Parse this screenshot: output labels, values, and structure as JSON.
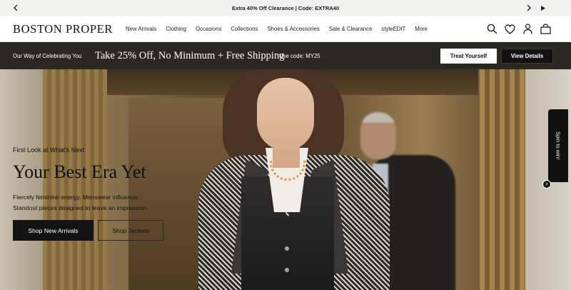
{
  "announcement": {
    "text": "Extra 40% Off Clearance | Code: EXTRA40",
    "prev_icon": "chevron-left-icon",
    "next_icon": "chevron-right-icon",
    "play_icon": "play-icon"
  },
  "header": {
    "logo": "BOSTON PROPER",
    "nav": [
      "New Arrivals",
      "Clothing",
      "Occasions",
      "Collections",
      "Shoes & Accessories",
      "Sale & Clearance",
      "styleEDIT",
      "More"
    ],
    "icons": [
      "search-icon",
      "heart-icon",
      "user-icon",
      "bag-icon"
    ]
  },
  "promo": {
    "tagline": "Our Way of Celebrating You",
    "headline": "Take 25% Off, No Minimum + Free Shipping",
    "code": "Use code: MY25",
    "treat_button": "Treat Yourself",
    "details_button": "View Details"
  },
  "hero": {
    "eyebrow": "First Look at What's Next",
    "title": "Your Best Era Yet",
    "sub_line1": "Fiercely feminine energy. Menswear influence.",
    "sub_line2": "Standout pieces designed to leave an impression.",
    "primary_button": "Shop New Arrivals",
    "secondary_button": "Shop Jackets"
  },
  "spin": {
    "label": "Spin to win!",
    "close": "×"
  }
}
